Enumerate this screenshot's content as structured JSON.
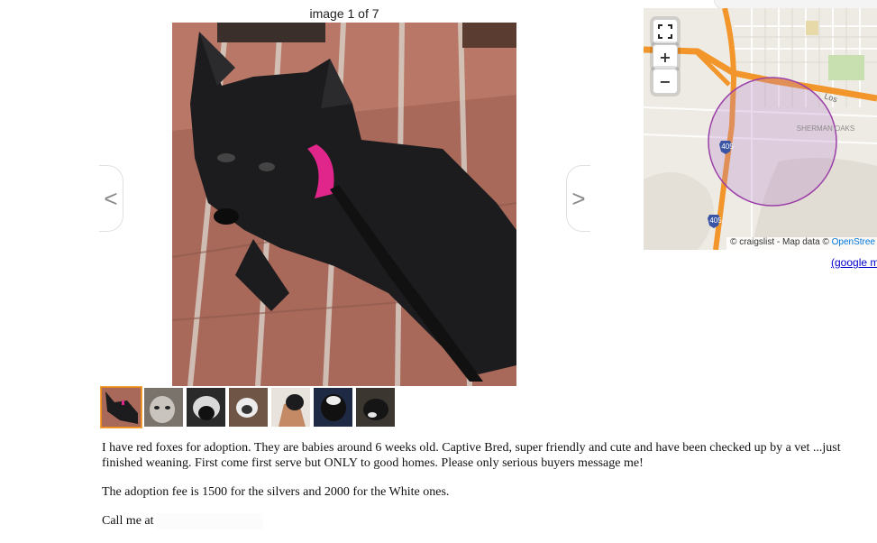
{
  "gallery": {
    "counter": "image 1 of 7",
    "prev_label": "<",
    "next_label": ">",
    "thumbnail_count": 7
  },
  "map": {
    "place_label": "SHERMAN OAKS",
    "shield_1": "405",
    "shield_2": "405",
    "road_label": "Los",
    "attribution_prefix": "© craigslist - Map data ©",
    "attribution_link": "OpenStree",
    "google_link": "(google m"
  },
  "description": {
    "para1": "I have red foxes for adoption. They are babies around 6 weeks old. Captive Bred, super friendly and cute and have been checked up by a vet ...just finished weaning. First come first serve but ONLY to good homes. Please only serious buyers message me!",
    "para2": "The adoption fee is 1500 for the silvers and 2000 for the White ones.",
    "para3": "Call me at"
  },
  "colors": {
    "thumb_active_border": "#e88a17",
    "freeway": "#f2962c",
    "radius_circle": "#9b3fa8",
    "link": "#0000cc"
  }
}
